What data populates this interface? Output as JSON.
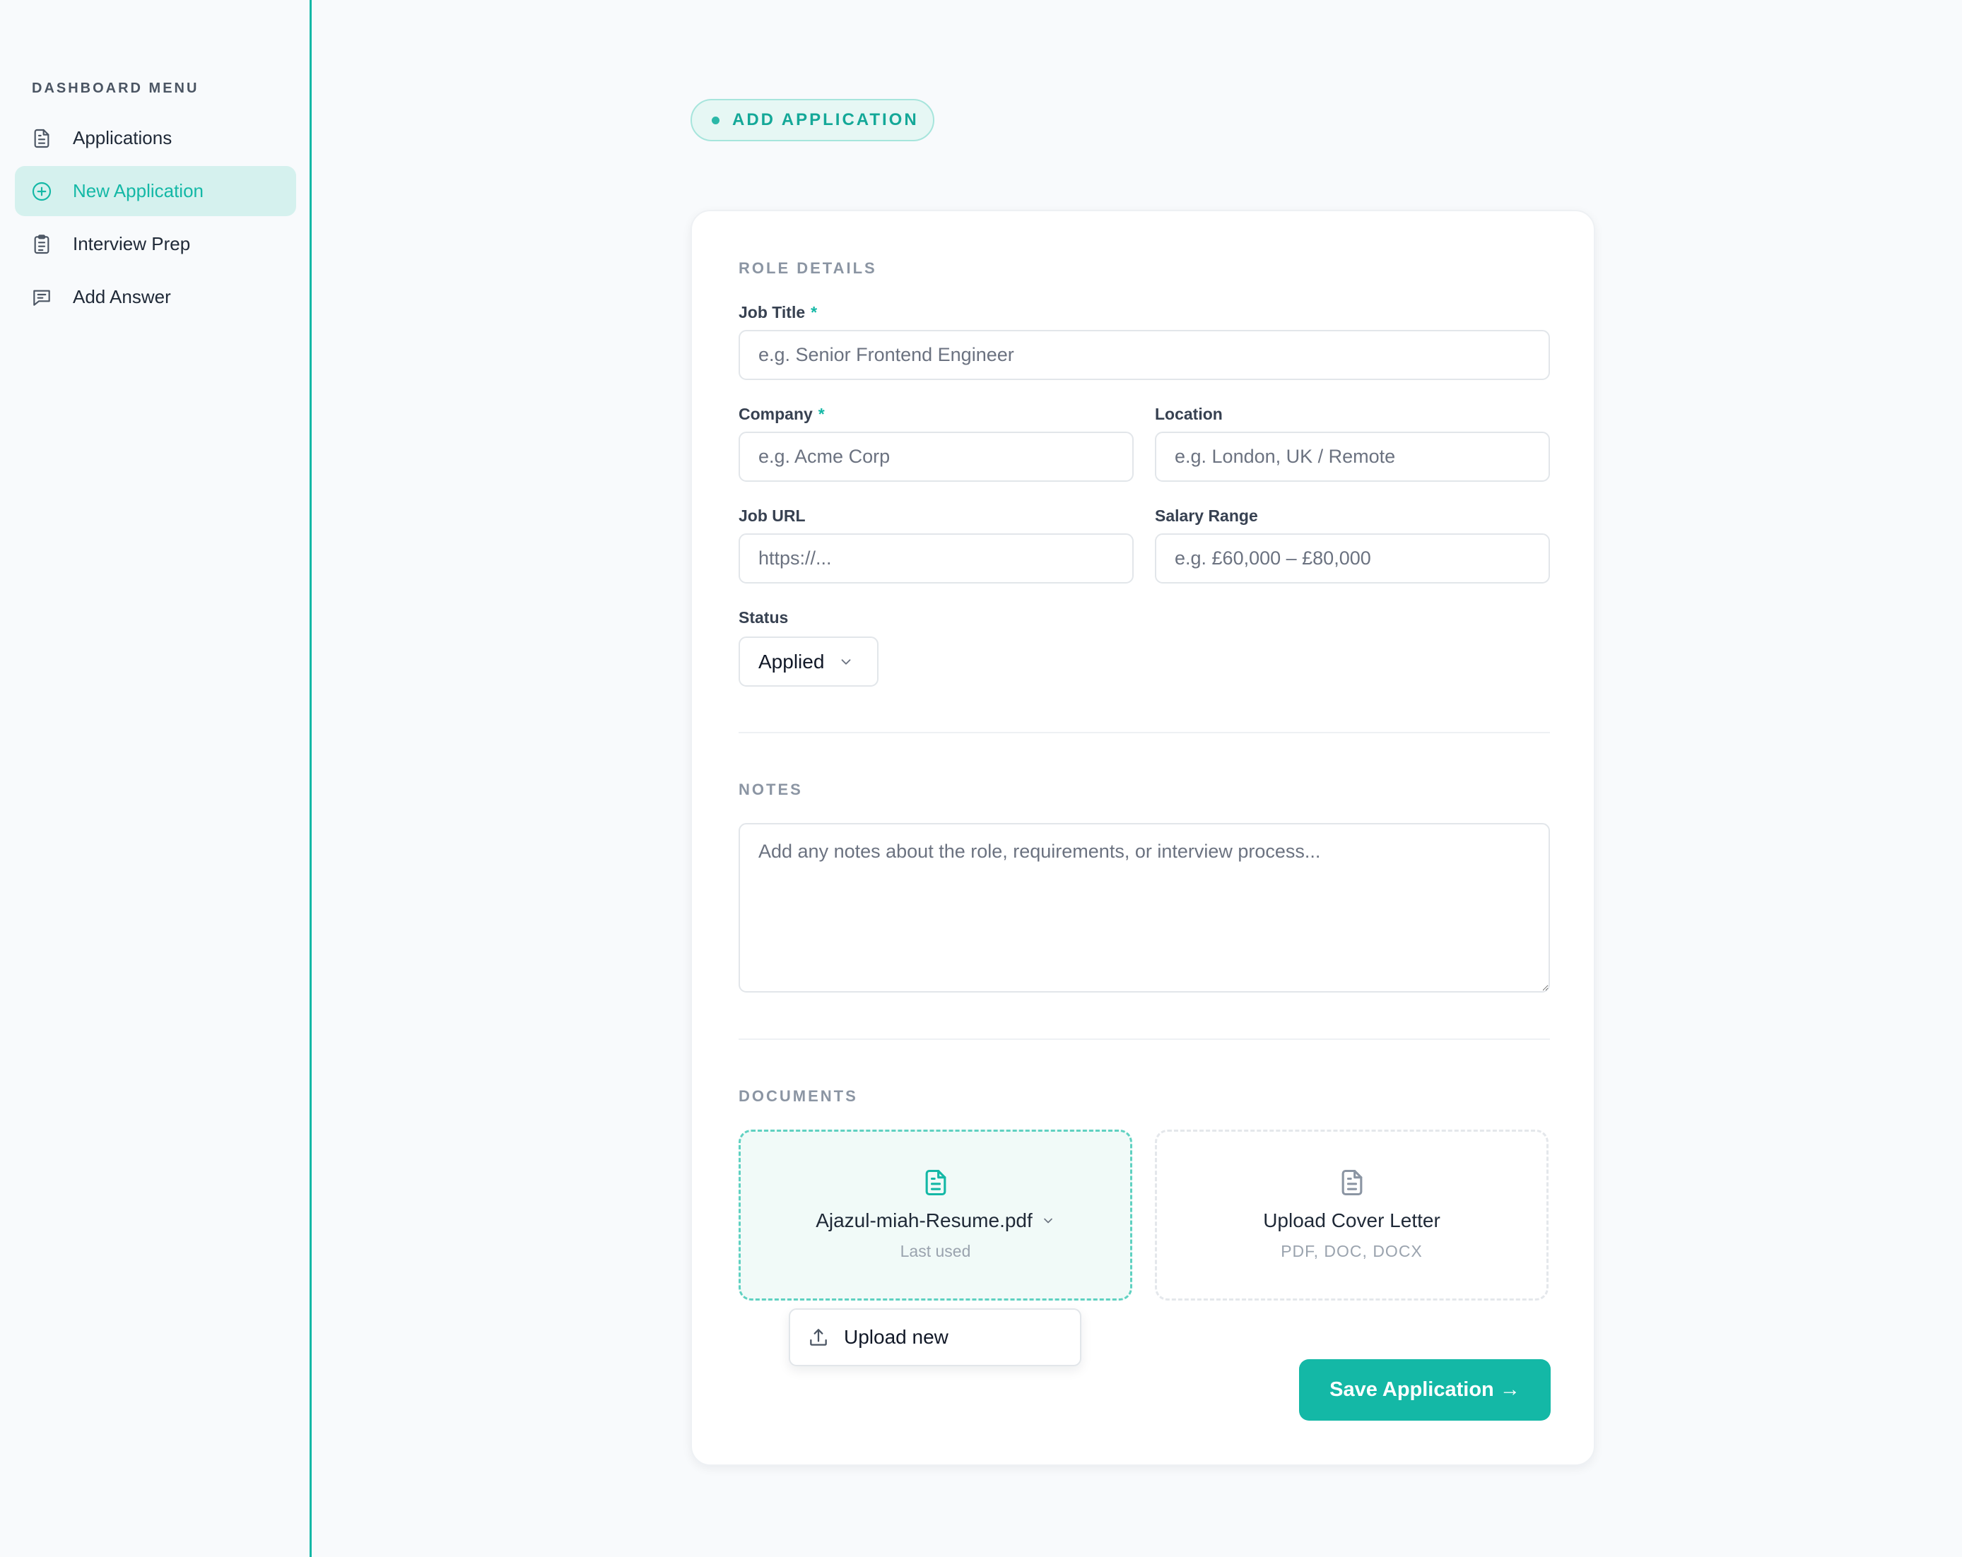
{
  "sidebar": {
    "menu_label": "DASHBOARD MENU",
    "items": [
      {
        "label": "Applications",
        "icon": "document-icon",
        "active": false
      },
      {
        "label": "New Application",
        "icon": "plus-circle-icon",
        "active": true
      },
      {
        "label": "Interview Prep",
        "icon": "clipboard-icon",
        "active": false
      },
      {
        "label": "Add Answer",
        "icon": "chat-icon",
        "active": false
      }
    ]
  },
  "header": {
    "pill_label": "ADD APPLICATION"
  },
  "form": {
    "role_section": "ROLE DETAILS",
    "required_mark": "*",
    "job_title": {
      "label": "Job Title",
      "placeholder": "e.g. Senior Frontend Engineer",
      "value": ""
    },
    "company": {
      "label": "Company",
      "placeholder": "e.g. Acme Corp",
      "value": ""
    },
    "location": {
      "label": "Location",
      "placeholder": "e.g. London, UK / Remote",
      "value": ""
    },
    "job_url": {
      "label": "Job URL",
      "placeholder": "https://...",
      "value": ""
    },
    "salary": {
      "label": "Salary Range",
      "placeholder": "e.g. £60,000 – £80,000",
      "value": ""
    },
    "status": {
      "label": "Status",
      "value": "Applied"
    },
    "notes_section": "NOTES",
    "notes": {
      "placeholder": "Add any notes about the role, requirements, or interview process...",
      "value": ""
    },
    "documents_section": "DOCUMENTS",
    "resume": {
      "filename": "Ajazul-miah-Resume.pdf",
      "sub": "Last used"
    },
    "cover_letter": {
      "title": "Upload Cover Letter",
      "sub": "PDF, DOC, DOCX"
    },
    "upload_menu": {
      "item": "Upload new"
    },
    "save_label": "Save Application →"
  },
  "colors": {
    "accent": "#14b8a6",
    "accent_light": "#d5f1ee",
    "background": "#f8fafc"
  }
}
